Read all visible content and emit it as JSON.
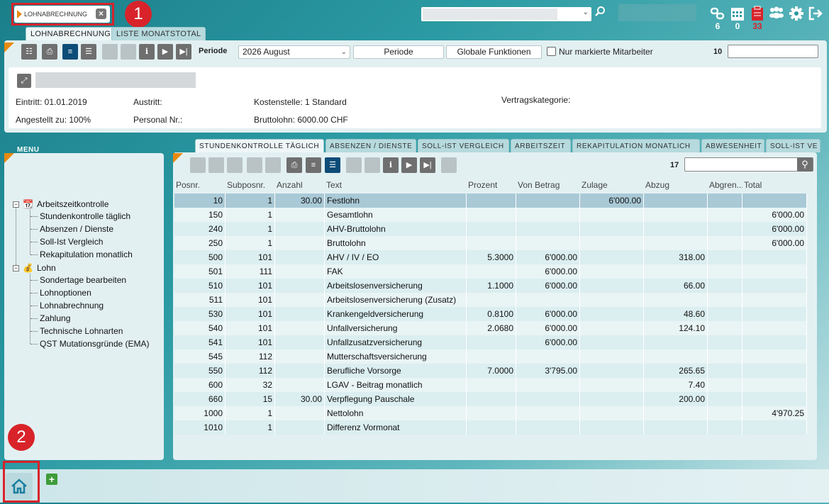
{
  "document_tab": {
    "label": "LOHNABRECHNUNG"
  },
  "callouts": {
    "one": "1",
    "two": "2"
  },
  "top_icons": {
    "counts": [
      "6",
      "0",
      "33"
    ]
  },
  "page_tabs": [
    {
      "label": "LOHNABRECHNUNG"
    },
    {
      "label": "LISTE MONATSTOTAL"
    }
  ],
  "toolbar": {
    "periode_label": "Periode",
    "periode_value": "2026  August",
    "periode_button": "Periode",
    "globale_button": "Globale Funktionen",
    "nur_markierte": "Nur markierte Mitarbeiter",
    "count": "10"
  },
  "employee": {
    "eintritt": "Eintritt: 01.01.2019",
    "austritt": "Austritt:",
    "kostenstelle": "Kostenstelle: 1 Standard",
    "vertragskategorie": "Vertragskategorie:",
    "angestellt": "Angestellt zu: 100%",
    "personal_nr": "Personal Nr.:",
    "bruttolohn": "Bruttolohn: 6000.00 CHF"
  },
  "menu": {
    "title": "MENU",
    "groups": [
      {
        "label": "Arbeitszeitkontrolle",
        "items": [
          "Stundenkontrolle täglich",
          "Absenzen / Dienste",
          "Soll-Ist Vergleich",
          "Rekapitulation monatlich"
        ]
      },
      {
        "label": "Lohn",
        "items": [
          "Sondertage bearbeiten",
          "Lohnoptionen",
          "Lohnabrechnung",
          "Zahlung",
          "Technische Lohnarten",
          "QST Mutationsgründe (EMA)"
        ]
      }
    ]
  },
  "content_tabs": [
    "STUNDENKONTROLLE TÄGLICH",
    "ABSENZEN / DIENSTE",
    "SOLL-IST VERGLEICH",
    "ARBEITSZEIT",
    "REKAPITULATION MONATLICH",
    "ABWESENHEIT",
    "SOLL-IST VE"
  ],
  "content_count": "17",
  "table": {
    "headers": [
      "Posnr.",
      "Subposnr.",
      "Anzahl",
      "Text",
      "Prozent",
      "Von Betrag",
      "Zulage",
      "Abzug",
      "Abgren...",
      "Total"
    ],
    "rows": [
      [
        "10",
        "1",
        "30.00",
        "Festlohn",
        "",
        "",
        "6'000.00",
        "",
        "",
        ""
      ],
      [
        "150",
        "1",
        "",
        "Gesamtlohn",
        "",
        "",
        "",
        "",
        "",
        "6'000.00"
      ],
      [
        "240",
        "1",
        "",
        "AHV-Bruttolohn",
        "",
        "",
        "",
        "",
        "",
        "6'000.00"
      ],
      [
        "250",
        "1",
        "",
        "Bruttolohn",
        "",
        "",
        "",
        "",
        "",
        "6'000.00"
      ],
      [
        "500",
        "101",
        "",
        "AHV / IV / EO",
        "5.3000",
        "6'000.00",
        "",
        "318.00",
        "",
        ""
      ],
      [
        "501",
        "111",
        "",
        "FAK",
        "",
        "6'000.00",
        "",
        "",
        "",
        ""
      ],
      [
        "510",
        "101",
        "",
        "Arbeitslosenversicherung",
        "1.1000",
        "6'000.00",
        "",
        "66.00",
        "",
        ""
      ],
      [
        "511",
        "101",
        "",
        "Arbeitslosenversicherung (Zusatz)",
        "",
        "",
        "",
        "",
        "",
        ""
      ],
      [
        "530",
        "101",
        "",
        "Krankengeldversicherung",
        "0.8100",
        "6'000.00",
        "",
        "48.60",
        "",
        ""
      ],
      [
        "540",
        "101",
        "",
        "Unfallversicherung",
        "2.0680",
        "6'000.00",
        "",
        "124.10",
        "",
        ""
      ],
      [
        "541",
        "101",
        "",
        "Unfallzusatzversicherung",
        "",
        "6'000.00",
        "",
        "",
        "",
        ""
      ],
      [
        "545",
        "112",
        "",
        "Mutterschaftsversicherung",
        "",
        "",
        "",
        "",
        "",
        ""
      ],
      [
        "550",
        "112",
        "",
        "Berufliche Vorsorge",
        "7.0000",
        "3'795.00",
        "",
        "265.65",
        "",
        ""
      ],
      [
        "600",
        "32",
        "",
        "LGAV - Beitrag monatlich",
        "",
        "",
        "",
        "7.40",
        "",
        ""
      ],
      [
        "660",
        "15",
        "30.00",
        "Verpflegung Pauschale",
        "",
        "",
        "",
        "200.00",
        "",
        ""
      ],
      [
        "1000",
        "1",
        "",
        "Nettolohn",
        "",
        "",
        "",
        "",
        "",
        "4'970.25"
      ],
      [
        "1010",
        "1",
        "",
        "Differenz Vormonat",
        "",
        "",
        "",
        "",
        "",
        ""
      ]
    ]
  },
  "colors": {
    "accent_orange": "#e78a12",
    "callout_red": "#d8232a",
    "toolbar_active": "#0e4c78"
  }
}
